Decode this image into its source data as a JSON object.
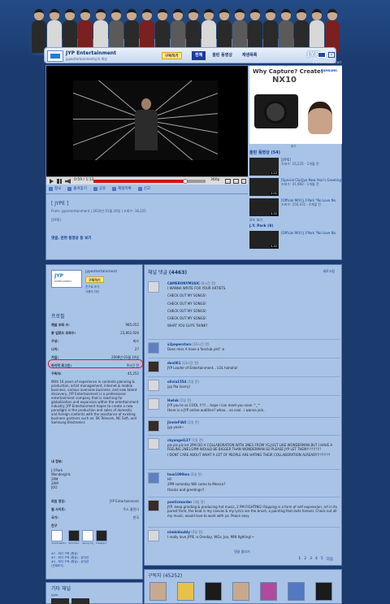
{
  "header": {
    "channel_name": "JYP Entertainment",
    "channel_sub": "jypentertainment님의 채널",
    "subscribe": "구독하기",
    "tabs": [
      "전체",
      "올린 동영상",
      "재생목록"
    ],
    "brand": "JYP ENTERTAINMENT"
  },
  "player": {
    "time": "0:59 / 1:12",
    "quality": "360p",
    "progress": 0.82
  },
  "video_actions": [
    "정보",
    "즐겨찾기",
    "공유",
    "재생목록",
    "신고"
  ],
  "video": {
    "title": "[ JYPE ]",
    "meta": "From: jypentertainment | 2010년 01월 20일 | 조회수: 18,225",
    "tag": "[JYPE]",
    "link": "댓글, 관련 동영상 등 보기"
  },
  "ad": {
    "headline": "Why Capture? Create!",
    "model": "NX10",
    "brand": "SAMSUNG",
    "label": "광고"
  },
  "related": {
    "title": "올린 동영상 (54)",
    "items": [
      {
        "title": "[JYPE]",
        "meta": "조회수: 16,225 - 1개월 전",
        "dur": "1:12"
      },
      {
        "title": "[Special Clip]Jyo New Year's Greeting",
        "meta": "조회수: 41,960 - 1개월 전",
        "dur": "2:01"
      },
      {
        "title": "[Official M/V] J.Y.Park \"No Love No",
        "meta": "조회수: 250,031 - 4개월 전",
        "dur": "5:32"
      }
    ],
    "more": "모두 보기",
    "sub_title": "J.Y. Park (8)",
    "extra_item": {
      "title": "[Official M/V] J.Y.Park \"No Love No",
      "dur": "5:32"
    }
  },
  "profile": {
    "name": "jypentertainment",
    "subscribe": "구독하기",
    "add_friend": "친구로 추가",
    "block": "사용자 차단",
    "section": "프로필",
    "stats": [
      {
        "label": "채널 조회 수:",
        "value": "985,052"
      },
      {
        "label": "총 업로드 조회수:",
        "value": "23,802,926"
      },
      {
        "label": "구성:",
        "value": "회사"
      },
      {
        "label": "나이:",
        "value": "27"
      },
      {
        "label": "가입:",
        "value": "2008년 01월 24일"
      },
      {
        "label": "마지막 로그인:",
        "value": "9시간 전"
      },
      {
        "label": "구독자:",
        "value": "45,252"
      }
    ],
    "about": "With 10 years of experience in contents planning & production, artist management, internet & mobile business, various overseas business, and new talent discovery, JYP Entertainment is a professional entertainment company that is reaching for globalization and expansion within the entertainment industry. JYP Entertainment hopes to create a new paradigm in the production and sales of domestic and foreign contents with the assistance of existing business partners such as; SK Telecom, NC Soft, and Samsung Electronics",
    "artists_label": "내 정보:",
    "artists": [
      "J.Y.Park",
      "Wondergirls",
      "2PM",
      "2AM",
      "JOO"
    ],
    "company_label": "회원 명칭:",
    "company": "JYP Entertainment",
    "site_label": "웹 사이트:",
    "site": "주소 올린다",
    "country_label": "국가:",
    "country": "한국",
    "friends_label": "친구",
    "friend_caps": [
      "imnotdead1",
      "2pmdom",
      "spoolyng",
      "kdoapp1"
    ],
    "activity": [
      "#7 - 최다 구독 (항상)",
      "#7 - 최다 구독 (항상) - 뮤지션",
      "#4 - 최다 구독 (항상) - 뮤지션",
      "(전체보기)"
    ]
  },
  "other_channels": {
    "title": "기타 채널",
    "sub": "Jyplo"
  },
  "comments": {
    "title": "채널 댓글",
    "count": "(4463)",
    "new": "새로고침",
    "items": [
      {
        "user": "CAMERONYMUSIC",
        "date": "(6시간 전)",
        "lines": [
          "I WANNA WRITE FOR YOUR ARTISTS.",
          "",
          "CHECK OUT MY SONGS!",
          "",
          "CHECK OUT MY SONGS!",
          "",
          "CHECK OUT MY SONGS!",
          "",
          "CHECK OUT MY SONGS!",
          "",
          "WHAT YOU GUYS THINK?"
        ]
      },
      {
        "user": "s2paperstars",
        "date": "(10시간 전)",
        "lines": [
          "Does miss A have a fanclub yet? :o"
        ]
      },
      {
        "user": "devil01",
        "date": "(13시간 전)",
        "lines": [
          "JYP Leader of Entertainment... LOL hahaha!"
        ]
      },
      {
        "user": "olivia1554",
        "date": "(1일 전)",
        "lines": [
          "jyp ftw (sorry)"
        ]
      },
      {
        "user": "Hwlak",
        "date": "(1일 전)",
        "lines": [
          "JYP you're so COOL !!!!!... hope i can meet you soon ^_^",
          "there is a JYP online audition? whoo... so cool.. i wanna join.."
        ]
      },
      {
        "user": "JinnieFIAO",
        "date": "(1일 전)",
        "lines": [
          "jyp yeah~"
        ]
      },
      {
        "user": "ckyangel127",
        "date": "(1일 전)",
        "lines": [
          "plz plz plz let 2PM DO A COLLABORATION WITH 2NE1 FROM YG,JUST LIKE WONDERMAN BUT I HAVE A FEELING 2NE1/2PM WOULD BE BIGGER THAN WONDERMAN SO PLEASE JYP LET THEM!!!!!!!!!!!",
          "I DONT CARE ABOUT WHAT A LOT OF PEOPLE ARE HATING THEIR COLLABORATION ALREADY!!!!!!!!!!"
        ]
      },
      {
        "user": "laus1090mx",
        "date": "(2일 전)",
        "lines": [
          "Hi!",
          "2PM someday Will come to Mexico?",
          "thanks and greetings!!"
        ]
      },
      {
        "user": "poeticmarder",
        "date": "(3일 전)",
        "lines": [
          "JYP, keep grinding & producing hot music, 2 PM FIGHTING! Rapping is a form of self expression, art in its purest form, the beat is my canvas & my lyrics are the brush, a painting that lasts forever. Check out all my music, would love to work with ya. Peace easy"
        ]
      },
      {
        "user": "nimbidoubly",
        "date": "(3일 전)",
        "lines": [
          "I really love JYPE :o Oneday, WGs, Joo, MIN fighting!~"
        ]
      }
    ],
    "more": "댓글 올리기",
    "pages": [
      "1",
      "2",
      "3",
      "4",
      "5",
      "다음"
    ]
  },
  "subscribers": {
    "title": "구독자",
    "count": "(45252)"
  }
}
